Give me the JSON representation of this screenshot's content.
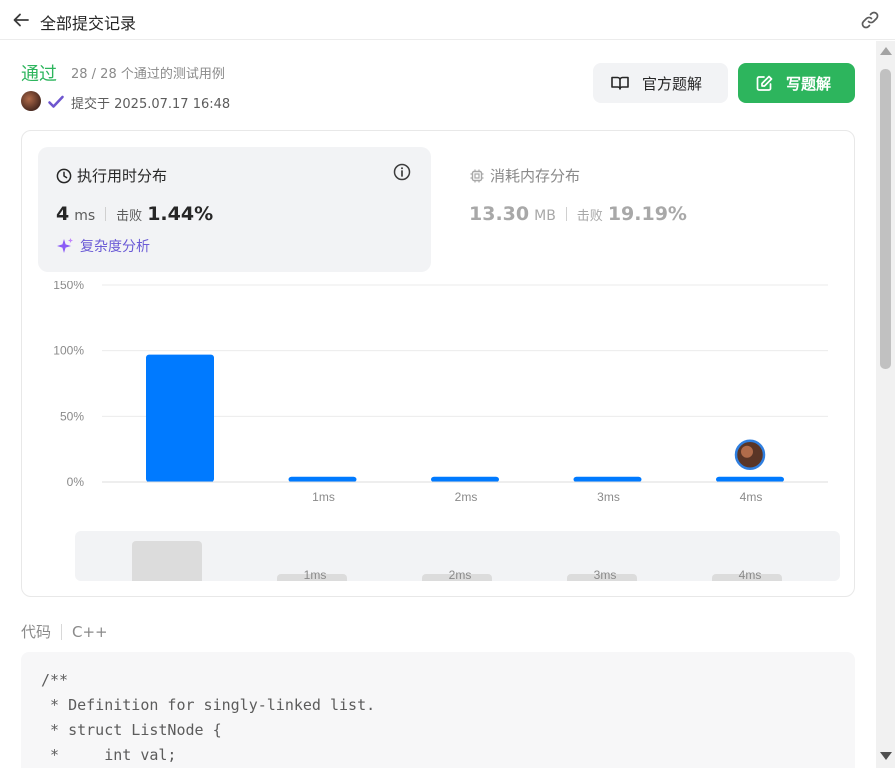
{
  "header": {
    "title": "全部提交记录",
    "back_icon": "arrow-left-icon",
    "link_icon": "link-icon"
  },
  "submission": {
    "status": "通过",
    "cases": "28 / 28 个通过的测试用例",
    "submitted_at": "提交于 2025.07.17 16:48",
    "status_color": "#2db55d"
  },
  "buttons": {
    "official_solution": "官方题解",
    "write_solution": "写题解"
  },
  "runtime": {
    "title": "执行用时分布",
    "value": "4",
    "unit": "ms",
    "beat_label": "击败",
    "beat_value": "1.44%",
    "complexity_label": "复杂度分析"
  },
  "memory": {
    "title": "消耗内存分布",
    "value": "13.30",
    "unit": "MB",
    "beat_label": "击败",
    "beat_value": "19.19%"
  },
  "chart_data": {
    "type": "bar",
    "categories": [
      "",
      "1ms",
      "2ms",
      "3ms",
      "4ms"
    ],
    "values": [
      97,
      4,
      4,
      4,
      4
    ],
    "yticks": [
      "0%",
      "50%",
      "100%",
      "150%"
    ],
    "ylim": [
      0,
      150
    ],
    "bar_color": "#007aff",
    "highlight_category": "4ms",
    "grid": true
  },
  "mini_chart": {
    "labels": [
      "",
      "1ms",
      "2ms",
      "3ms",
      "4ms"
    ]
  },
  "code": {
    "label": "代码",
    "language": "C++",
    "lines": [
      "/**",
      " * Definition for singly-linked list.",
      " * struct ListNode {",
      " *     int val;"
    ]
  }
}
